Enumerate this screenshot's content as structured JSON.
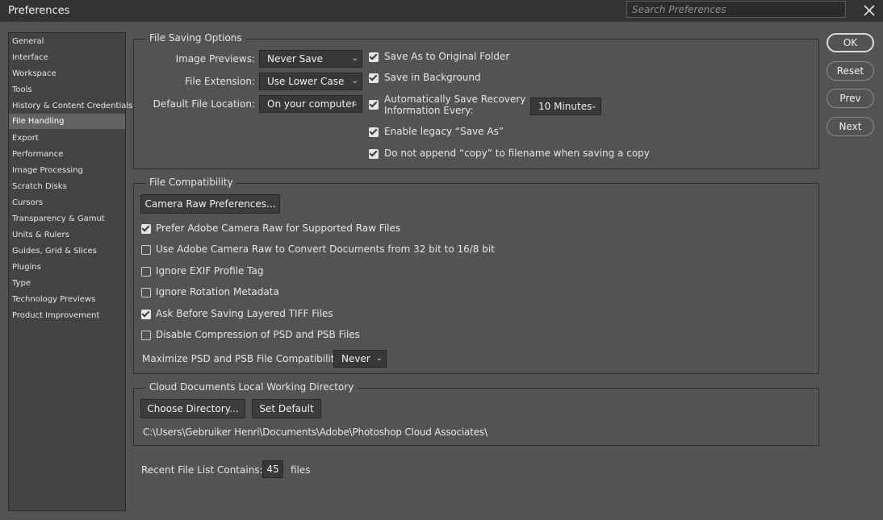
{
  "window": {
    "title": "Preferences"
  },
  "search": {
    "placeholder": "Search Preferences"
  },
  "sidebar": {
    "items": [
      {
        "label": "General"
      },
      {
        "label": "Interface"
      },
      {
        "label": "Workspace"
      },
      {
        "label": "Tools"
      },
      {
        "label": "History & Content Credentials"
      },
      {
        "label": "File Handling"
      },
      {
        "label": "Export"
      },
      {
        "label": "Performance"
      },
      {
        "label": "Image Processing"
      },
      {
        "label": "Scratch Disks"
      },
      {
        "label": "Cursors"
      },
      {
        "label": "Transparency & Gamut"
      },
      {
        "label": "Units & Rulers"
      },
      {
        "label": "Guides, Grid & Slices"
      },
      {
        "label": "Plugins"
      },
      {
        "label": "Type"
      },
      {
        "label": "Technology Previews"
      },
      {
        "label": "Product Improvement"
      }
    ],
    "active": "File Handling"
  },
  "buttons": {
    "ok": "OK",
    "reset": "Reset",
    "prev": "Prev",
    "next": "Next"
  },
  "file_saving": {
    "legend": "File Saving Options",
    "image_previews_label": "Image Previews:",
    "image_previews_value": "Never Save",
    "file_extension_label": "File Extension:",
    "file_extension_value": "Use Lower Case",
    "default_location_label": "Default File Location:",
    "default_location_value": "On your computer",
    "save_as_original": {
      "label": "Save As to Original Folder",
      "checked": true
    },
    "save_in_background": {
      "label": "Save in Background",
      "checked": true
    },
    "auto_save": {
      "label_line1": "Automatically Save Recovery",
      "label_line2": "Information Every:",
      "checked": true
    },
    "auto_save_interval": "10 Minutes",
    "legacy_save_as": {
      "label": "Enable legacy “Save As”",
      "checked": true
    },
    "no_copy_append": {
      "label": "Do not append “copy” to filename when saving a copy",
      "checked": true
    }
  },
  "compat": {
    "legend": "File Compatibility",
    "camera_raw_prefs_button": "Camera Raw Preferences...",
    "options": [
      {
        "label": "Prefer Adobe Camera Raw for Supported Raw Files",
        "checked": true
      },
      {
        "label": "Use Adobe Camera Raw to Convert Documents from 32 bit to 16/8 bit",
        "checked": false
      },
      {
        "label": "Ignore EXIF Profile Tag",
        "checked": false
      },
      {
        "label": "Ignore Rotation Metadata",
        "checked": false
      },
      {
        "label": "Ask Before Saving Layered TIFF Files",
        "checked": true
      },
      {
        "label": "Disable Compression of PSD and PSB Files",
        "checked": false
      }
    ],
    "maximize_label": "Maximize PSD and PSB File Compatibility:",
    "maximize_value": "Never"
  },
  "cloud": {
    "legend": "Cloud Documents Local Working Directory",
    "choose_button": "Choose Directory...",
    "set_default_button": "Set Default",
    "path": "C:\\Users\\Gebruiker Henri\\Documents\\Adobe\\Photoshop Cloud Associates\\"
  },
  "recent": {
    "label": "Recent File List Contains:",
    "value": "45",
    "suffix": "files"
  }
}
